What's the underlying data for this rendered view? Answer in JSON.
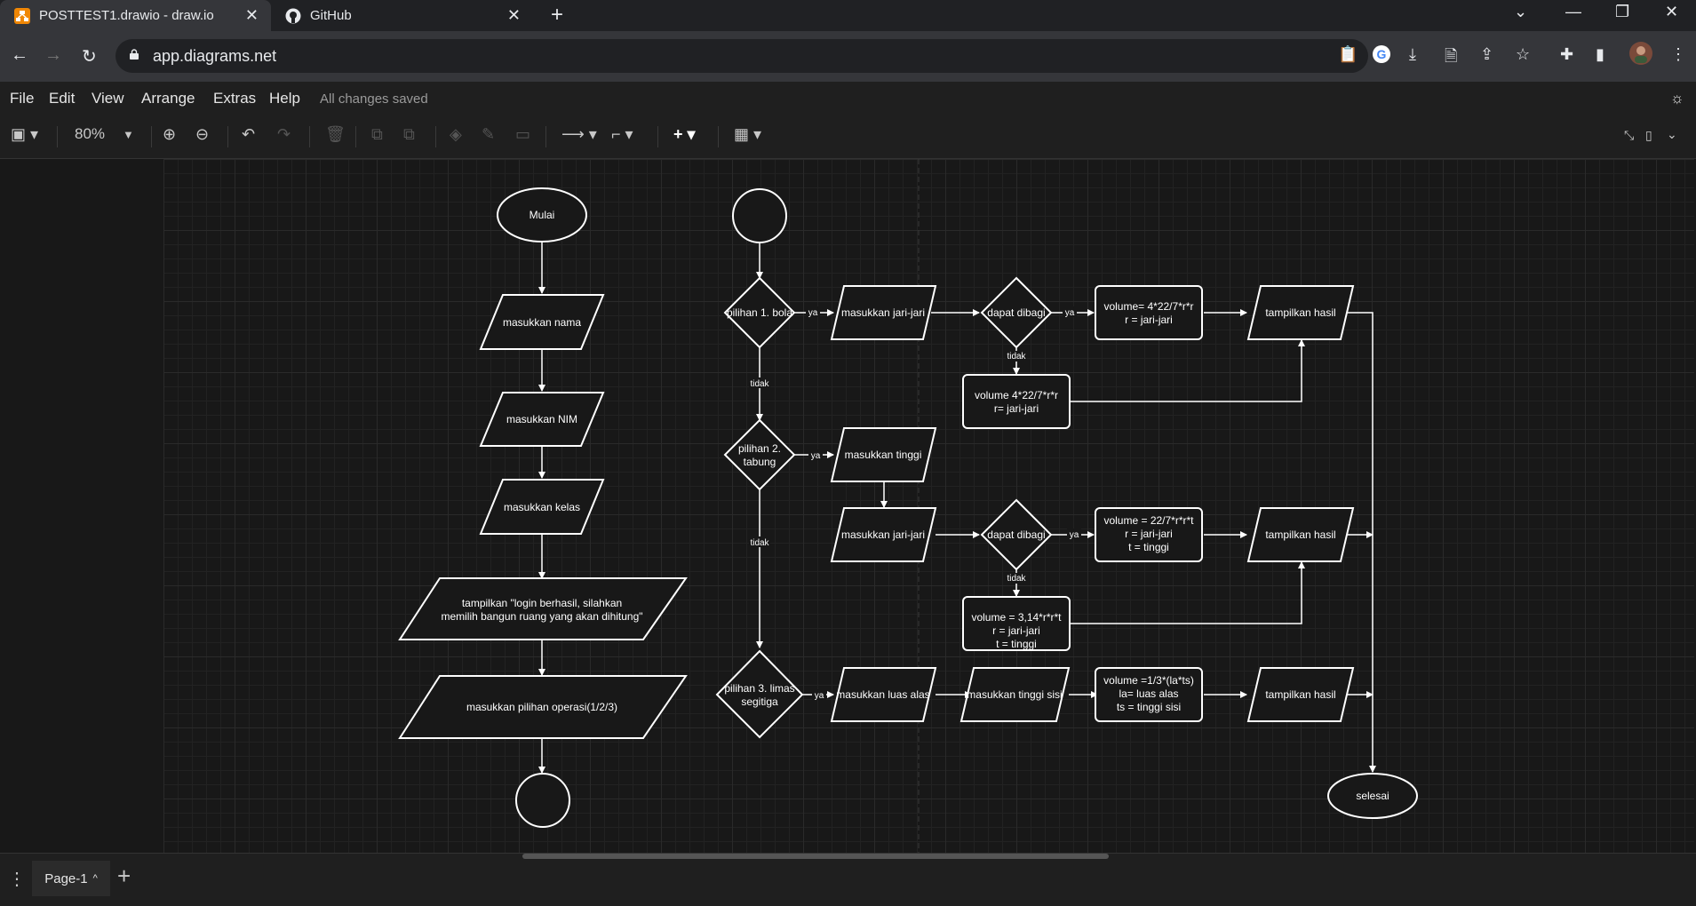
{
  "browser": {
    "tabs": [
      {
        "title": "POSTTEST1.drawio - draw.io",
        "active": true,
        "icon": "drawio-icon"
      },
      {
        "title": "GitHub",
        "active": false,
        "icon": "github-icon"
      }
    ],
    "url": "app.diagrams.net"
  },
  "menu": {
    "items": [
      "File",
      "Edit",
      "View",
      "Arrange",
      "Extras",
      "Help"
    ],
    "status": "All changes saved"
  },
  "toolbar": {
    "zoom": "80%"
  },
  "diagram": {
    "left": {
      "start": "Mulai",
      "in_nama": "masukkan nama",
      "in_nim": "masukkan NIM",
      "in_kelas": "masukkan kelas",
      "out_login_1": "tampilkan \"login berhasil, silahkan",
      "out_login_2": "memilih bangun ruang yang akan dihitung\"",
      "in_pilihan": "masukkan pilihan operasi(1/2/3)"
    },
    "row1": {
      "decision": "pilihan 1. bola",
      "input": "masukkan jari-jari",
      "check": "dapat dibagi",
      "proc_1": "volume= 4*22/7*r*r",
      "proc_2": "r = jari-jari",
      "alt_1": "volume 4*22/7*r*r",
      "alt_2": "r= jari-jari",
      "output": "tampilkan hasil"
    },
    "row2": {
      "decision_1": "pilihan 2.",
      "decision_2": "tabung",
      "input_tinggi": "masukkan tinggi",
      "input_jari": "masukkan jari-jari",
      "check": "dapat dibagi",
      "proc_1": "volume = 22/7*r*r*t",
      "proc_2": "r = jari-jari",
      "proc_3": "t = tinggi",
      "alt_1": "volume = 3,14*r*r*t",
      "alt_2": "r = jari-jari",
      "alt_3": "t = tinggi",
      "output": "tampilkan hasil"
    },
    "row3": {
      "decision_1": "pilihan 3. limas",
      "decision_2": "segitiga",
      "input_alas": "masukkan luas alas",
      "input_sisi": "masukkan tinggi sisi",
      "proc_1": "volume =1/3*(la*ts)",
      "proc_2": "la= luas alas",
      "proc_3": "ts = tinggi sisi",
      "output": "tampilkan hasil"
    },
    "labels": {
      "ya": "ya",
      "tidak": "tidak"
    },
    "end": "selesai"
  },
  "pages": {
    "current": "Page-1"
  }
}
